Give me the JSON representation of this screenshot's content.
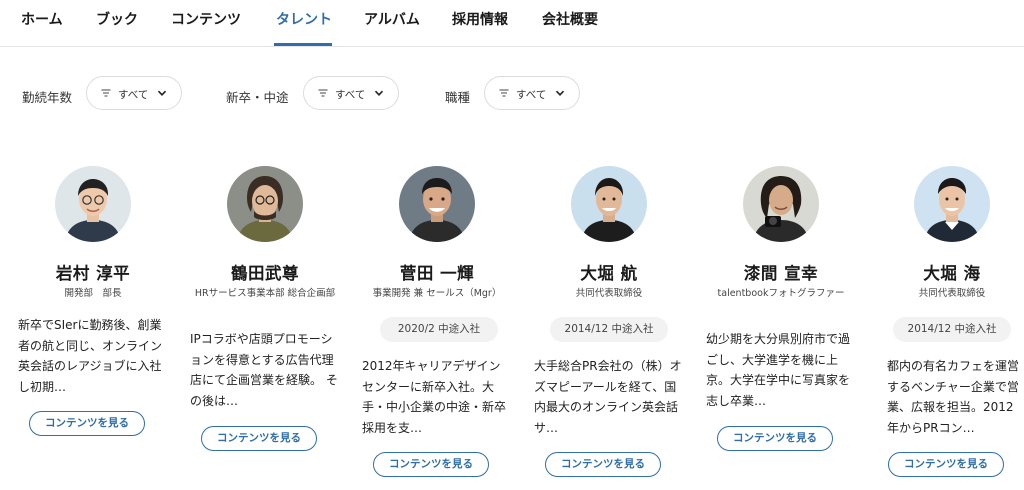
{
  "nav": {
    "items": [
      "ホーム",
      "ブック",
      "コンテンツ",
      "タレント",
      "アルバム",
      "採用情報",
      "会社概要"
    ],
    "active": "タレント"
  },
  "filters": [
    {
      "label": "勤続年数",
      "value": "すべて"
    },
    {
      "label": "新卒・中途",
      "value": "すべて"
    },
    {
      "label": "職種",
      "value": "すべて"
    }
  ],
  "cta_label": "コンテンツを見る",
  "talents": [
    {
      "name": "岩村 淳平",
      "role": "開発部　部長",
      "joined": "",
      "description": "新卒でSIerに勤務後、創業者の航と同じ、オンライン英会話のレアジョブに入社し初期…",
      "avatar_bg": "#dfe6ea"
    },
    {
      "name": "鶴田武尊",
      "role": "HRサービス事業本部 総合企画部",
      "joined": "",
      "description": "IPコラボや店頭プロモーションを得意とする広告代理店にて企画営業を経験。 その後は…",
      "avatar_bg": "#8b8f88"
    },
    {
      "name": "菅田 一輝",
      "role": "事業開発 兼 セールス（Mgr）",
      "joined": "2020/2  中途入社",
      "description": "2012年キャリアデザインセンターに新卒入社。大手・中小企業の中途・新卒採用を支…",
      "avatar_bg": "#6f7c86"
    },
    {
      "name": "大堀 航",
      "role": "共同代表取締役",
      "joined": "2014/12  中途入社",
      "description": "大手総合PR会社の（株）オズマピーアールを経て、国内最大のオンライン英会話サ…",
      "avatar_bg": "#c9dfee"
    },
    {
      "name": "漆間 宣幸",
      "role": "talentbookフォトグラファー",
      "joined": "",
      "description": "幼少期を大分県別府市で過ごし、大学進学を機に上京。大学在学中に写真家を志し卒業…",
      "avatar_bg": "#d7d9d2"
    },
    {
      "name": "大堀 海",
      "role": "共同代表取締役",
      "joined": "2014/12  中途入社",
      "description": "都内の有名カフェを運営するベンチャー企業で営業、広報を担当。2012年からPRコン…",
      "avatar_bg": "#cfe2f1"
    }
  ],
  "colors": {
    "accent": "#2f6ea8",
    "pill_bg": "#f2f2f2",
    "border": "#dcdcdc"
  }
}
